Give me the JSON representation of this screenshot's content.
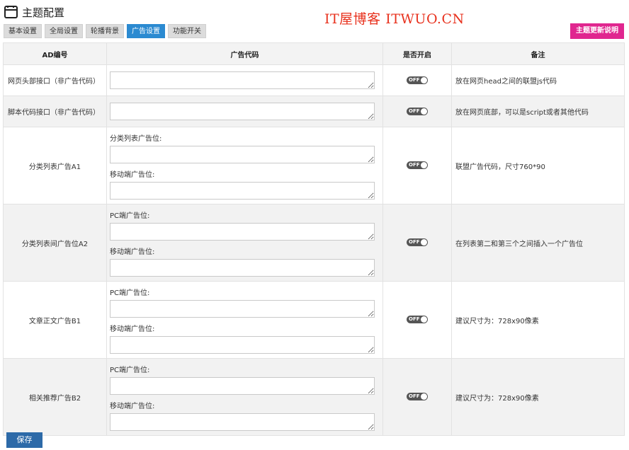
{
  "header": {
    "title": "主题配置",
    "icon": "window-icon"
  },
  "watermark": "IT屋博客 ITWUO.CN",
  "tabs": [
    {
      "label": "基本设置",
      "active": false
    },
    {
      "label": "全局设置",
      "active": false
    },
    {
      "label": "轮播背景",
      "active": false
    },
    {
      "label": "广告设置",
      "active": true
    },
    {
      "label": "功能开关",
      "active": false
    }
  ],
  "update_button": "主题更新说明",
  "table": {
    "headers": {
      "id": "AD编号",
      "code": "广告代码",
      "enabled": "是否开启",
      "note": "备注"
    },
    "rows": [
      {
        "name": "网页头部接口（非广告代码）",
        "switch": "OFF",
        "note": "放在网页head之间的联盟js代码"
      },
      {
        "name": "脚本代码接口（非广告代码）",
        "switch": "OFF",
        "note": "放在网页底部，可以是script或者其他代码"
      },
      {
        "name": "分类列表广告A1",
        "slot1": "分类列表广告位:",
        "slot2": "移动端广告位:",
        "switch": "OFF",
        "note": "联盟广告代码，尺寸760*90"
      },
      {
        "name": "分类列表间广告位A2",
        "slot1": "PC端广告位:",
        "slot2": "移动端广告位:",
        "switch": "OFF",
        "note": "在列表第二和第三个之间插入一个广告位"
      },
      {
        "name": "文章正文广告B1",
        "slot1": "PC端广告位:",
        "slot2": "移动端广告位:",
        "switch": "OFF",
        "note": "建议尺寸为：728x90像素"
      },
      {
        "name": "相关推荐广告B2",
        "slot1": "PC端广告位:",
        "slot2": "移动端广告位:",
        "switch": "OFF",
        "note": "建议尺寸为：728x90像素"
      }
    ]
  },
  "save_button": "保存",
  "colors": {
    "active_tab": "#2b8ad1",
    "update_button": "#e0268f",
    "save_button": "#2d6aa8",
    "watermark": "#e8321e"
  }
}
